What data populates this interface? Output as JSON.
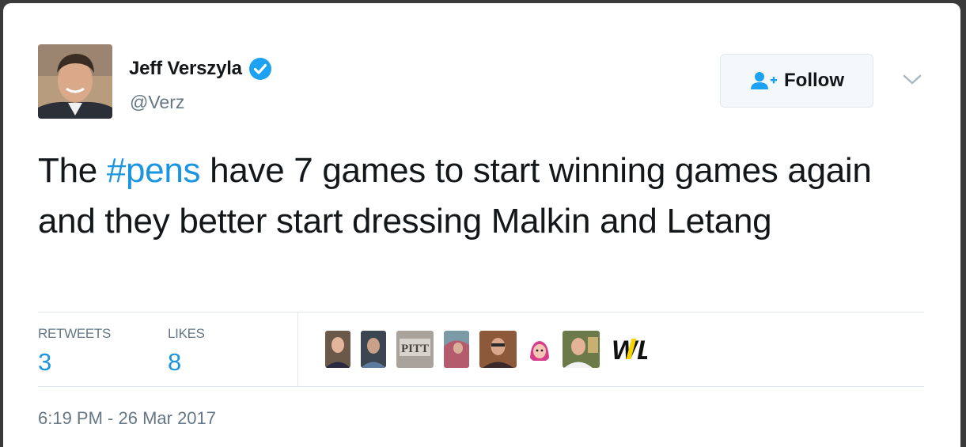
{
  "author": {
    "name": "Jeff Verszyla",
    "handle": "@Verz",
    "verified": true,
    "avatar_icon": "profile-photo"
  },
  "actions": {
    "follow_label": "Follow",
    "follow_icon": "add-user-icon",
    "menu_icon": "chevron-down-icon"
  },
  "tweet": {
    "text_before": "The ",
    "hashtag": "#pens",
    "text_after": " have 7 games to start winning games again and they better start dressing Malkin and Letang"
  },
  "stats": {
    "retweets_label": "RETWEETS",
    "retweets_value": "3",
    "likes_label": "LIKES",
    "likes_value": "8"
  },
  "likers_badge": "WL",
  "pitt_badge": "PITT",
  "timestamp": "6:19 PM - 26 Mar 2017",
  "colors": {
    "link": "#1b95e0",
    "verified": "#1da1f2",
    "text": "#14171a",
    "muted": "#657786"
  }
}
